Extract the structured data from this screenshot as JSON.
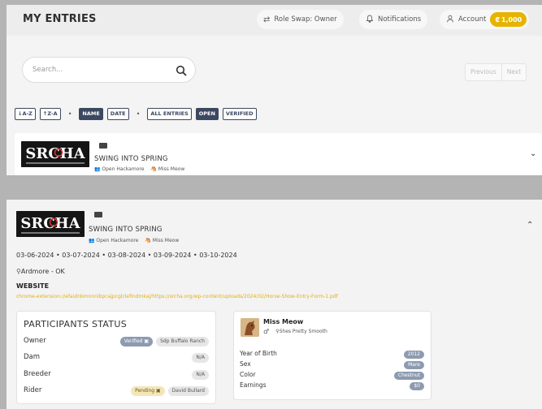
{
  "header": {
    "title": "MY ENTRIES",
    "role_swap": "Role Swap: Owner",
    "notifications": "Notifications",
    "account": "Account",
    "coins": "1,000"
  },
  "search": {
    "placeholder": "Search..."
  },
  "pager": {
    "previous": "Previous",
    "next": "Next"
  },
  "filters": {
    "sort_az": "A-Z",
    "sort_za": "Z-A",
    "name": "NAME",
    "date": "DATE",
    "all_entries": "ALL ENTRIES",
    "open": "OPEN",
    "verified": "VERIFIED"
  },
  "entry": {
    "logo_text": "SRCHA",
    "title": "SWING INTO SPRING",
    "division": "Open Hackamore",
    "horse": "Miss Meow",
    "dates": "03-06-2024 • 03-07-2024 • 03-08-2024 • 03-09-2024 • 03-10-2024",
    "location": "Ardmore - OK",
    "website_label": "WEBSITE",
    "website_url": "chrome-extension://efaidnbmnnnibpcajpcglclefindmkaj/https://srcha.org/wp-content/uploads/2024/02/Horse-Show-Entry-Form-1.pdf"
  },
  "participants": {
    "title": "PARTICIPANTS STATUS",
    "rows": [
      {
        "label": "Owner",
        "status": "Verified",
        "value": "Sdp Buffalo Ranch"
      },
      {
        "label": "Dam",
        "status": "",
        "value": "N/A"
      },
      {
        "label": "Breeder",
        "status": "",
        "value": "N/A"
      },
      {
        "label": "Rider",
        "status": "Pending",
        "value": "David Bullard"
      }
    ]
  },
  "horse_card": {
    "name": "Miss Meow",
    "sire": "Shes Pretty Smooth",
    "fields": [
      {
        "label": "Year of Birth",
        "value": "2012"
      },
      {
        "label": "Sex",
        "value": "Mare"
      },
      {
        "label": "Color",
        "value": "Chestnut"
      },
      {
        "label": "Earnings",
        "value": "$0"
      }
    ]
  },
  "colors": {
    "accent": "#e6b400",
    "navy": "#3c4860",
    "link": "#e5ae12",
    "badge": "#8d9bb0"
  }
}
